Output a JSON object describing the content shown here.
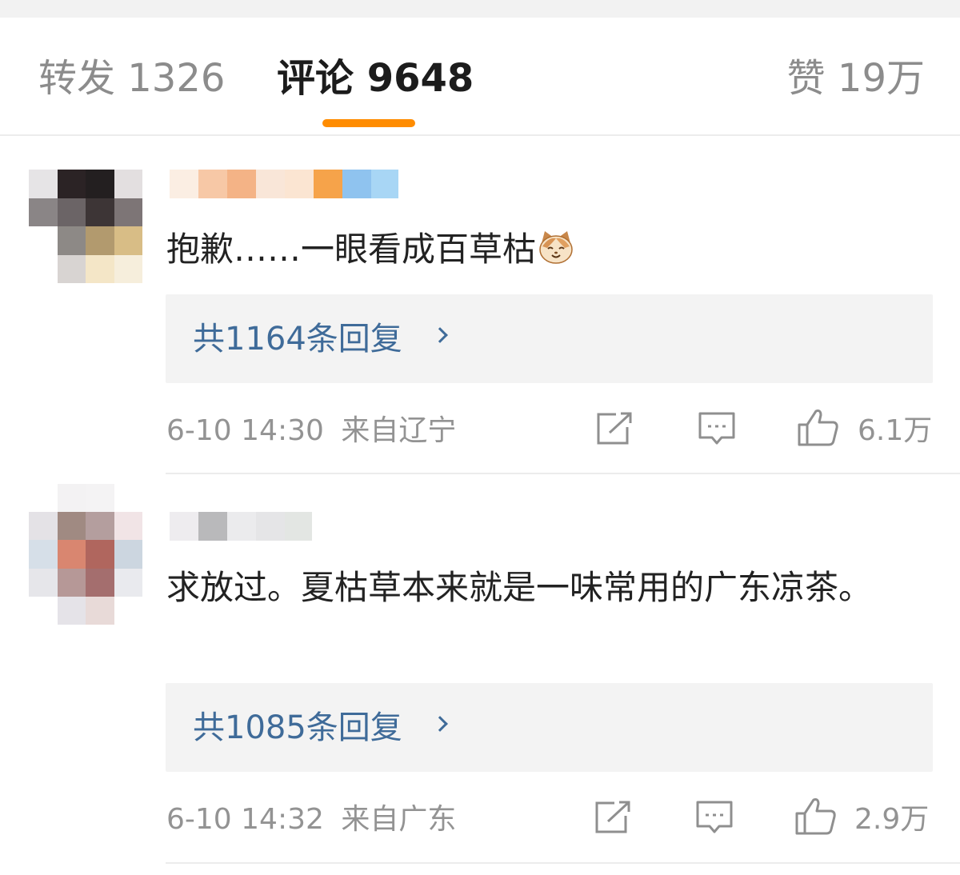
{
  "tabs": {
    "repost": "转发 1326",
    "comment": "评论 9648",
    "like": "赞 19万",
    "accent_color": "#ff8c00"
  },
  "comments": [
    {
      "text": "抱歉……一眼看成百草枯",
      "emoji": "cat-face-icon",
      "reply_link": "共1164条回复",
      "time": "6-10 14:30",
      "location": "来自辽宁",
      "likes": "6.1万"
    },
    {
      "text": "求放过。夏枯草本来就是一味常用的广东凉茶。",
      "reply_link": "共1085条回复",
      "time": "6-10 14:32",
      "location": "来自广东",
      "likes": "2.9万"
    }
  ],
  "colors": {
    "link": "#3f6b99",
    "meta": "#939393",
    "reply_bg": "#f3f3f3"
  }
}
